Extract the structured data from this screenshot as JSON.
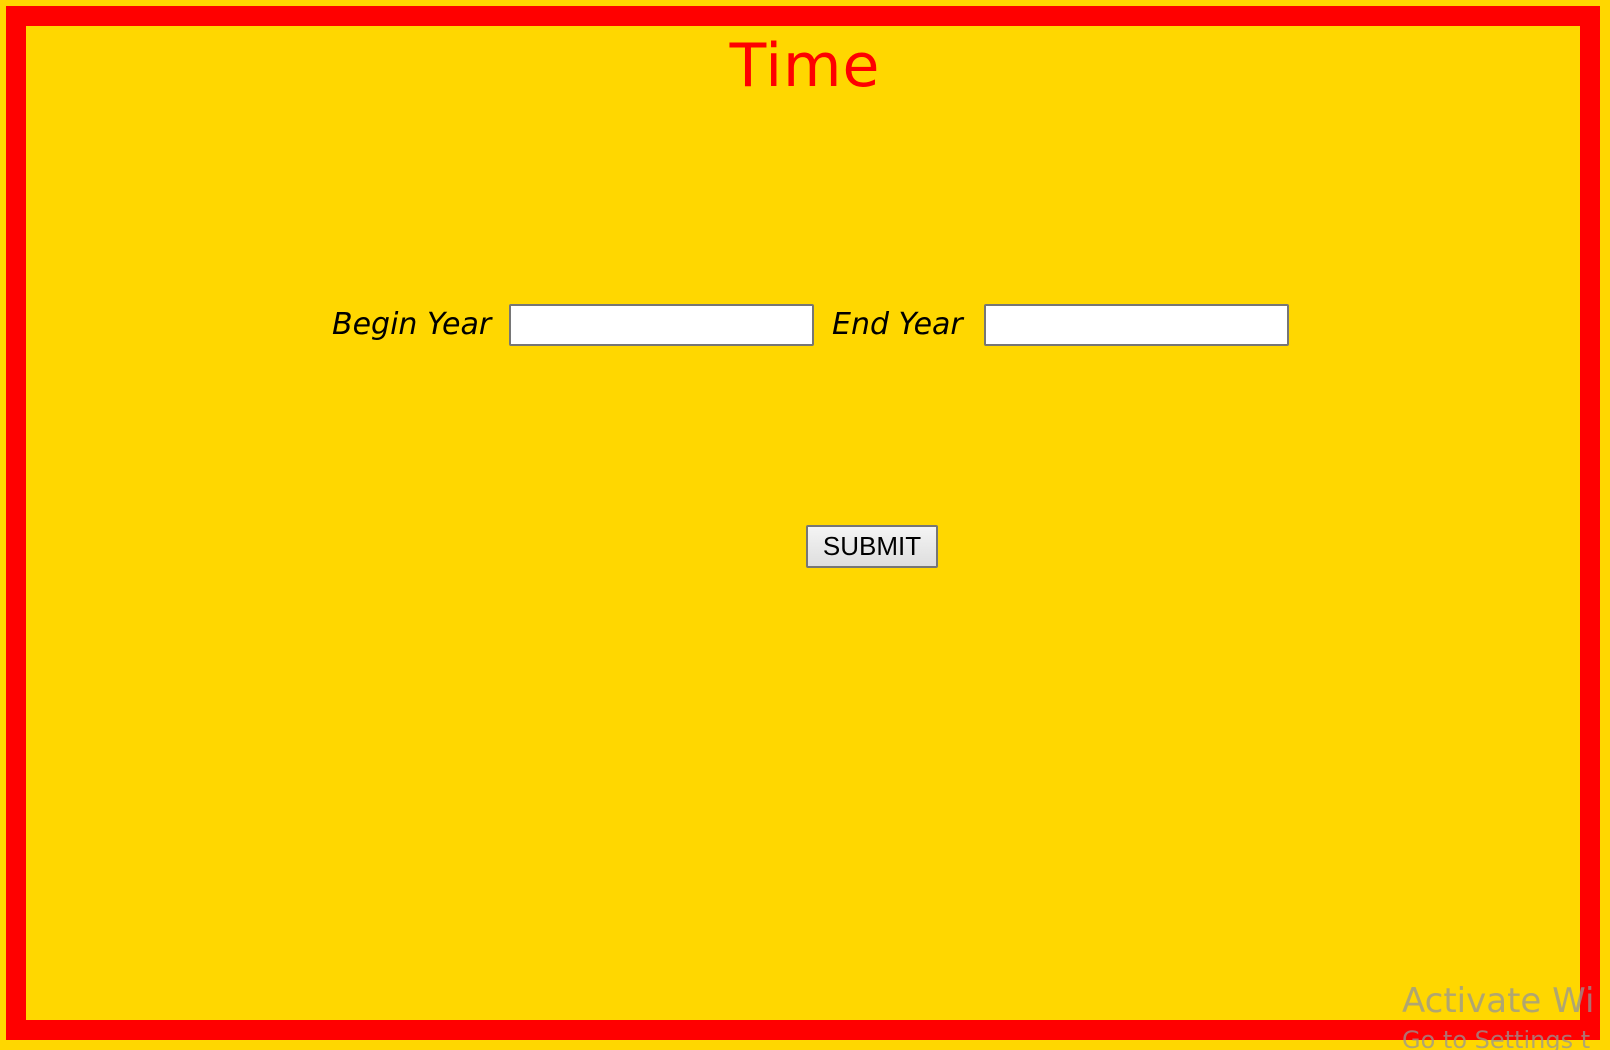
{
  "page": {
    "title": "Time",
    "colors": {
      "background": "#FFD700",
      "border": "#FF0000",
      "title": "#FF0000"
    }
  },
  "form": {
    "begin_year_label": "Begin Year",
    "begin_year_value": "",
    "end_year_label": "End Year",
    "end_year_value": "",
    "submit_label": "SUBMIT"
  },
  "overlay": {
    "activation_watermark": "Activate Wi",
    "activation_watermark_sub": "Go to Settings t"
  }
}
